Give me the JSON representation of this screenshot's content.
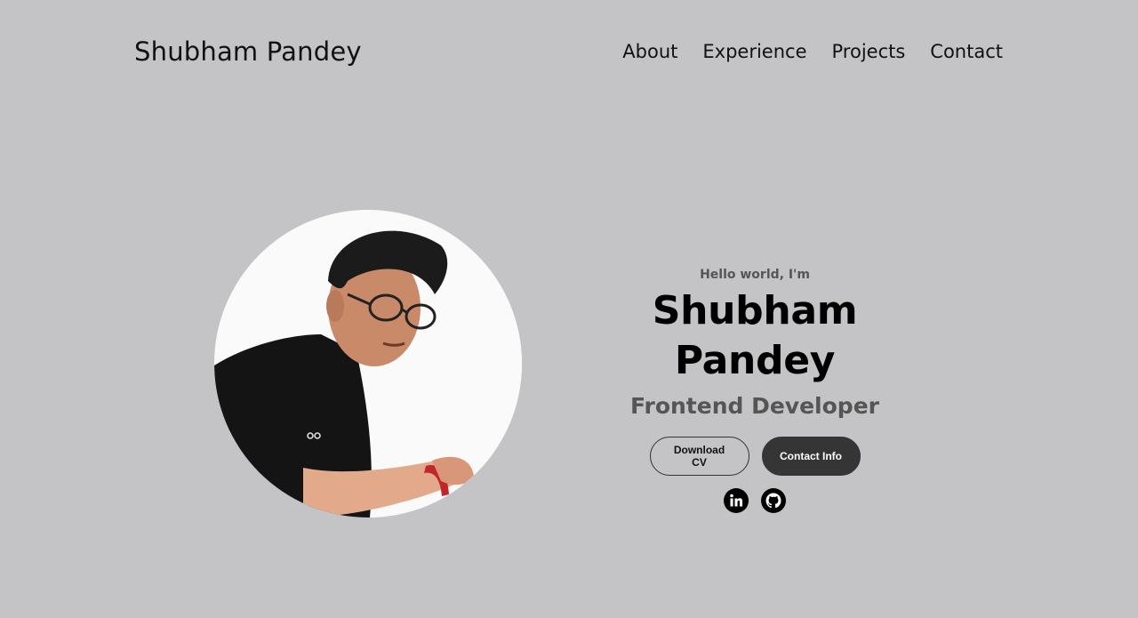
{
  "nav": {
    "logo": "Shubham Pandey",
    "links": [
      "About",
      "Experience",
      "Projects",
      "Contact"
    ]
  },
  "hero": {
    "greeting": "Hello world, I'm",
    "name": "Shubham Pandey",
    "role": "Frontend Developer",
    "buttons": {
      "download_cv": "Download CV",
      "contact_info": "Contact Info"
    },
    "socials": [
      "linkedin-icon",
      "github-icon"
    ]
  },
  "colors": {
    "background": "#c4c4c6",
    "solid_button": "#353535",
    "muted_text": "#555555"
  }
}
